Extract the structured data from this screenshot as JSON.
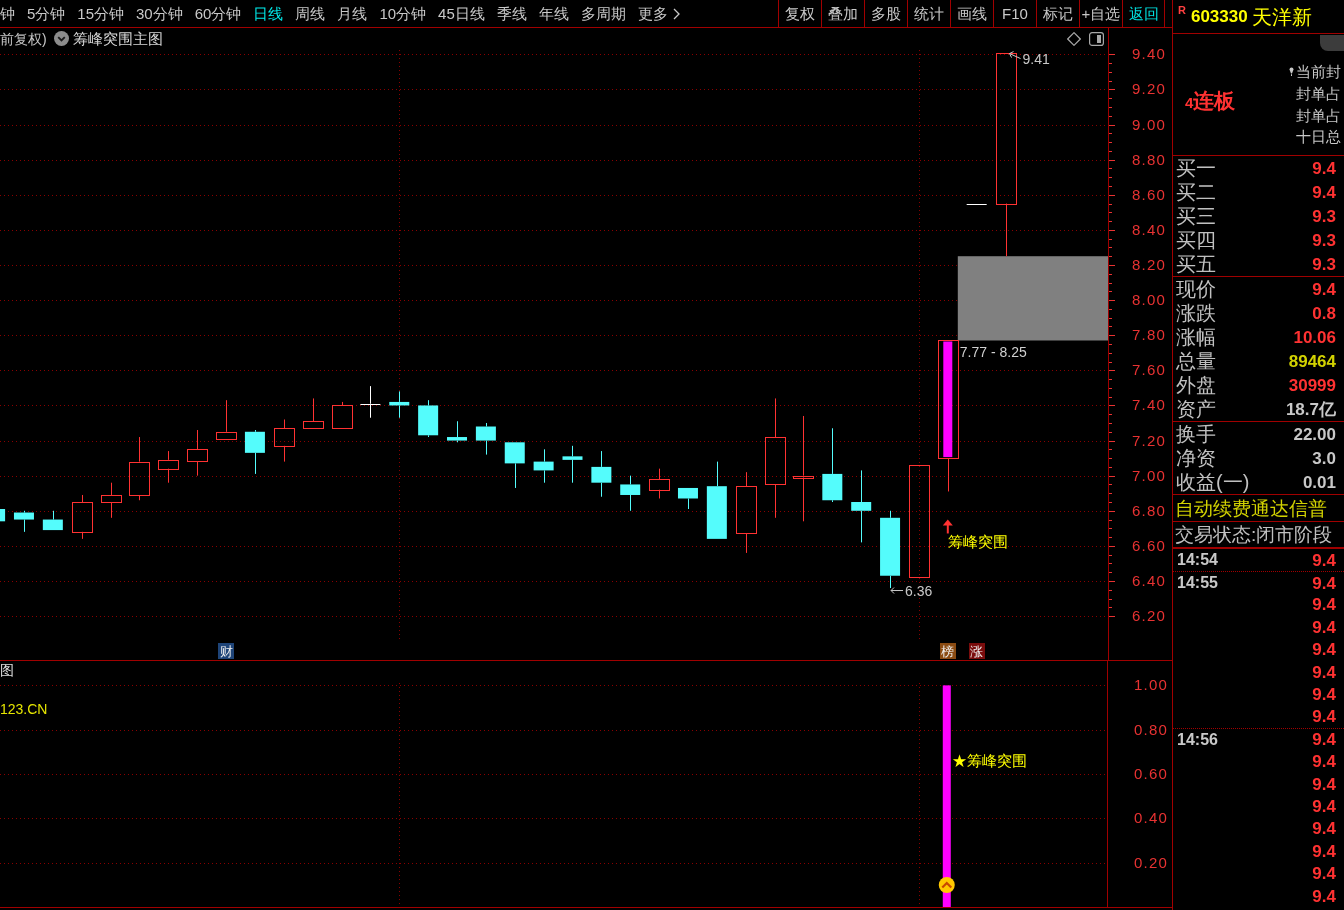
{
  "toolbar": {
    "periods": [
      {
        "label": "钟",
        "selected": false,
        "kind": "period"
      },
      {
        "label": "5分钟",
        "selected": false,
        "kind": "period"
      },
      {
        "label": "15分钟",
        "selected": false,
        "kind": "period"
      },
      {
        "label": "30分钟",
        "selected": false,
        "kind": "period"
      },
      {
        "label": "60分钟",
        "selected": false,
        "kind": "period"
      },
      {
        "label": "日线",
        "selected": true,
        "kind": "period"
      },
      {
        "label": "周线",
        "selected": false,
        "kind": "period"
      },
      {
        "label": "月线",
        "selected": false,
        "kind": "period"
      },
      {
        "label": "10分钟",
        "selected": false,
        "kind": "period"
      },
      {
        "label": "45日线",
        "selected": false,
        "kind": "period"
      },
      {
        "label": "季线",
        "selected": false,
        "kind": "period"
      },
      {
        "label": "年线",
        "selected": false,
        "kind": "period"
      },
      {
        "label": "多周期",
        "selected": false,
        "kind": "period"
      },
      {
        "label": "更多",
        "selected": false,
        "kind": "menu"
      }
    ],
    "tools": [
      {
        "label": "复权",
        "kind": "tool"
      },
      {
        "label": "叠加",
        "kind": "tool"
      },
      {
        "label": "多股",
        "kind": "tool"
      },
      {
        "label": "统计",
        "kind": "tool"
      },
      {
        "label": "画线",
        "kind": "tool"
      },
      {
        "label": "F10",
        "kind": "tool"
      },
      {
        "label": "标记",
        "kind": "tool"
      },
      {
        "label": "+自选",
        "kind": "tool"
      },
      {
        "label": "返回",
        "kind": "back"
      }
    ]
  },
  "security": {
    "market": "R",
    "code": "603330",
    "name": "天洋新"
  },
  "chart_header": {
    "adjustment": "前复权)",
    "formula": "筹峰突围主图"
  },
  "main_chart": {
    "price_axis": [
      "9.40",
      "9.20",
      "9.00",
      "8.80",
      "8.60",
      "8.40",
      "8.20",
      "8.00",
      "7.80",
      "7.60",
      "7.40",
      "7.20",
      "7.00",
      "6.80",
      "6.60",
      "6.40",
      "6.20"
    ],
    "high_label": "9.41",
    "low_label": "6.36",
    "gap_label": "7.77 - 8.25",
    "signal_label": "筹峰突围",
    "badges": [
      {
        "text": "财",
        "color": "#1e4478"
      },
      {
        "text": "榜",
        "color": "#8a4b12"
      },
      {
        "text": "涨",
        "color": "#7a0c0c"
      }
    ]
  },
  "indicator_panel": {
    "title": "图",
    "source": "123.CN",
    "chart_data": {
      "type": "bar",
      "categories": [
        null,
        null,
        null,
        null,
        null,
        null,
        null,
        null,
        null,
        null,
        null,
        null,
        null,
        null,
        null,
        null,
        null,
        null,
        null,
        null,
        null,
        null,
        null,
        null,
        null,
        null,
        null,
        null,
        null,
        null,
        null,
        null,
        null,
        null,
        null,
        null,
        null,
        null
      ],
      "ylim": [
        0,
        1.11
      ],
      "yticks": [
        {
          "value": 1.0,
          "label": "1.00"
        },
        {
          "value": 0.8,
          "label": "0.80"
        },
        {
          "value": 0.6,
          "label": "0.60"
        },
        {
          "value": 0.4,
          "label": "0.40"
        },
        {
          "value": 0.2,
          "label": "0.20"
        }
      ],
      "grid": true,
      "values": [
        0,
        0,
        0,
        0,
        0,
        0,
        0,
        0,
        0,
        0,
        0,
        0,
        0,
        0,
        0,
        0,
        0,
        0,
        0,
        0,
        0,
        0,
        0,
        0,
        0,
        0,
        0,
        0,
        0,
        0,
        0,
        0,
        1,
        0,
        0,
        null,
        null,
        null
      ],
      "annotations": [
        "★筹峰突围"
      ]
    }
  },
  "seal_panel": {
    "streak": "4连板",
    "lines": [
      {
        "text": "当前封",
        "kind": "flagged"
      },
      {
        "text": "封单占",
        "kind": "plain"
      },
      {
        "text": "封单占",
        "kind": "plain"
      },
      {
        "text": "十日总",
        "kind": "plain"
      }
    ]
  },
  "bids": [
    {
      "label": "买一",
      "price": "9.4"
    },
    {
      "label": "买二",
      "price": "9.4"
    },
    {
      "label": "买三",
      "price": "9.3"
    },
    {
      "label": "买四",
      "price": "9.3"
    },
    {
      "label": "买五",
      "price": "9.3"
    }
  ],
  "quote": [
    {
      "label": "现价",
      "value": "9.4",
      "color": "#ff3232"
    },
    {
      "label": "涨跌",
      "value": "0.8",
      "color": "#ff3232"
    },
    {
      "label": "涨幅",
      "value": "10.06",
      "color": "#ff3232"
    },
    {
      "label": "总量",
      "value": "89464",
      "color": "#d2d200"
    },
    {
      "label": "外盘",
      "value": "30999",
      "color": "#ff3232"
    },
    {
      "label": "资产",
      "value": "18.7亿",
      "color": "#c8c8c8"
    }
  ],
  "finance": [
    {
      "label": "换手",
      "value": "22.00"
    },
    {
      "label": "净资",
      "value": "3.0"
    },
    {
      "label": "收益(一)",
      "value": "0.01"
    }
  ],
  "notice": "自动续费通达信普",
  "trade_status": "交易状态:闭市阶段",
  "ticks": [
    {
      "time": "14:54",
      "price": "9.4"
    },
    {
      "time": "14:55",
      "price": "9.4"
    },
    {
      "price": "9.4"
    },
    {
      "price": "9.4"
    },
    {
      "price": "9.4"
    },
    {
      "price": "9.4"
    },
    {
      "price": "9.4"
    },
    {
      "price": "9.4"
    },
    {
      "time": "14:56",
      "price": "9.4"
    },
    {
      "price": "9.4"
    },
    {
      "price": "9.4"
    },
    {
      "price": "9.4"
    },
    {
      "price": "9.4"
    },
    {
      "price": "9.4"
    },
    {
      "price": "9.4"
    },
    {
      "price": "9.4"
    }
  ]
}
